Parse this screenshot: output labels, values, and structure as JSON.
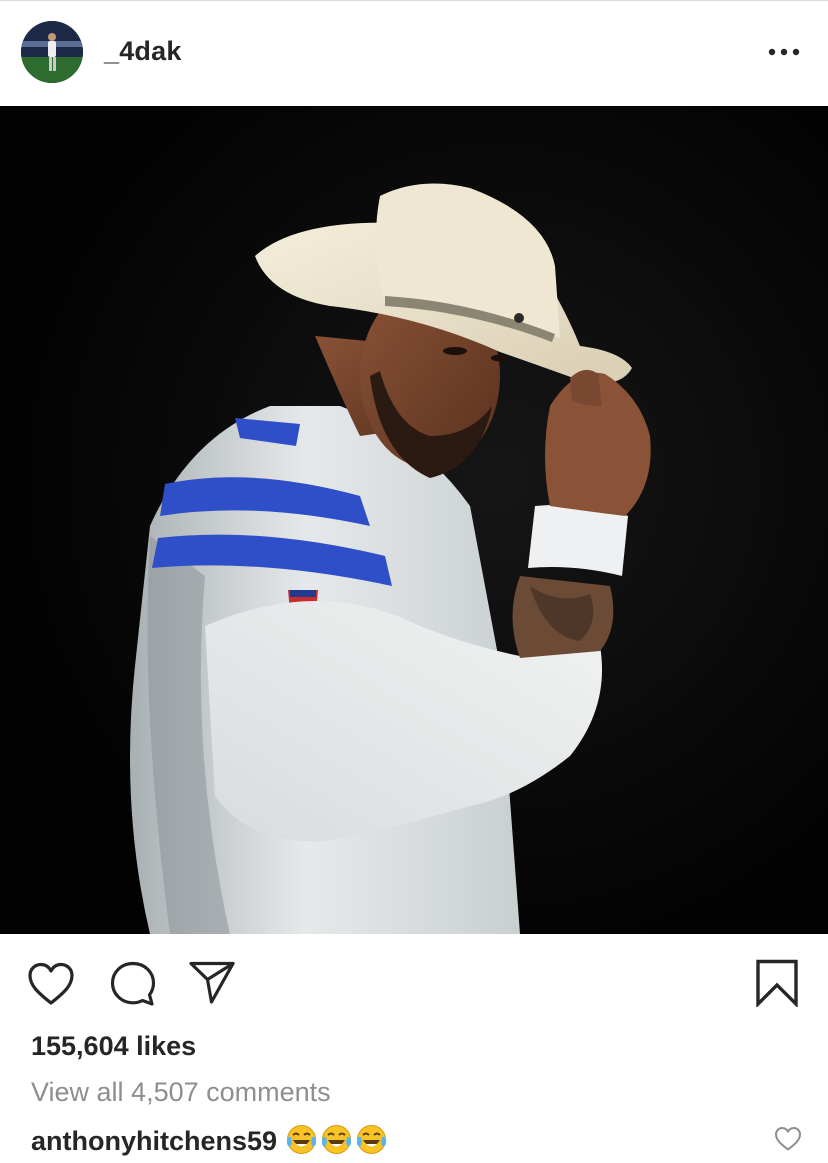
{
  "post": {
    "username": "_4dak",
    "likes_text": "155,604 likes",
    "view_comments_text": "View all 4,507 comments",
    "comment": {
      "user": "anthonyhitchens59",
      "emojis": [
        "face-with-tears-of-joy",
        "face-with-tears-of-joy",
        "face-with-tears-of-joy"
      ]
    }
  },
  "icons": {
    "more": "more-horizontal-icon",
    "like": "heart-icon",
    "comment": "comment-bubble-icon",
    "share": "paper-plane-icon",
    "save": "bookmark-icon",
    "comment_like": "small-heart-icon"
  },
  "colors": {
    "text": "#262626",
    "muted": "#8e8e8e",
    "photo_background": "#030303",
    "jersey_stripe": "#2f4fc8",
    "hat": "#efe7d2"
  }
}
